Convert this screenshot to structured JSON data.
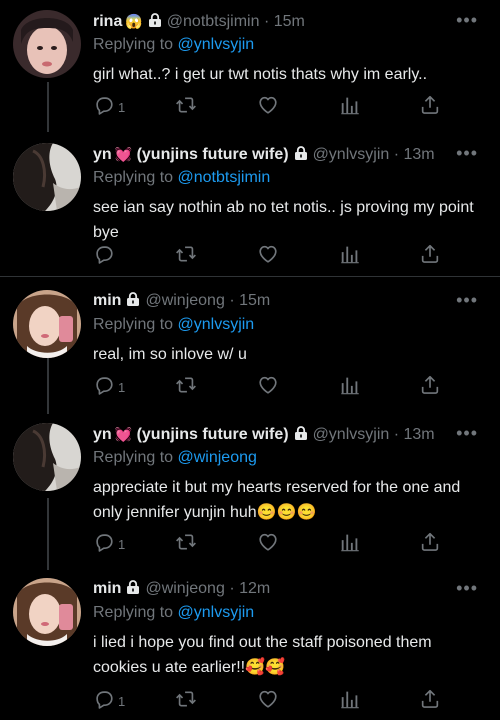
{
  "tweets": [
    {
      "name": "rina",
      "badge": "😱",
      "handle": "@notbtsjimin",
      "time": "· 15m",
      "reply_prefix": "Replying to",
      "reply_to": "@ynlvsyjin",
      "text": "girl what..? i get ur twt notis thats why im early..",
      "reply_count": "1"
    },
    {
      "name": "yn",
      "badge": "💓",
      "name_suffix": "(yunjins future wife)",
      "handle": "@ynlvsyjin",
      "time": "· 13m",
      "reply_prefix": "Replying to",
      "reply_to": "@notbtsjimin",
      "text": "see ian say nothin ab no tet notis.. js proving my point bye",
      "reply_count": ""
    },
    {
      "name": "min",
      "handle": "@winjeong",
      "time": "· 15m",
      "reply_prefix": "Replying to",
      "reply_to": "@ynlvsyjin",
      "text": "real, im so inlove w/ u",
      "reply_count": "1"
    },
    {
      "name": "yn",
      "badge": "💓",
      "name_suffix": "(yunjins future wife)",
      "handle": "@ynlvsyjin",
      "time": "· 13m",
      "reply_prefix": "Replying to",
      "reply_to": "@winjeong",
      "text": "appreciate it but my hearts reserved for the one and only jennifer yunjin huh",
      "text_emoji": "😊😊😊",
      "reply_count": "1"
    },
    {
      "name": "min",
      "handle": "@winjeong",
      "time": "· 12m",
      "reply_prefix": "Replying to",
      "reply_to": "@ynlvsyjin",
      "text": "i lied i hope you find out the staff poisoned them cookies u ate earlier!!",
      "text_emoji": "🥰🥰",
      "reply_count": "1"
    }
  ],
  "icons": {
    "reply": "reply-icon",
    "retweet": "retweet-icon",
    "like": "heart-icon",
    "views": "views-icon",
    "share": "share-icon",
    "more": "more-icon",
    "lock": "lock-icon"
  },
  "colors": {
    "background": "#000000",
    "text": "#e7e9ea",
    "muted": "#71767b",
    "link": "#1d9bf0",
    "divider": "#2f3336"
  }
}
